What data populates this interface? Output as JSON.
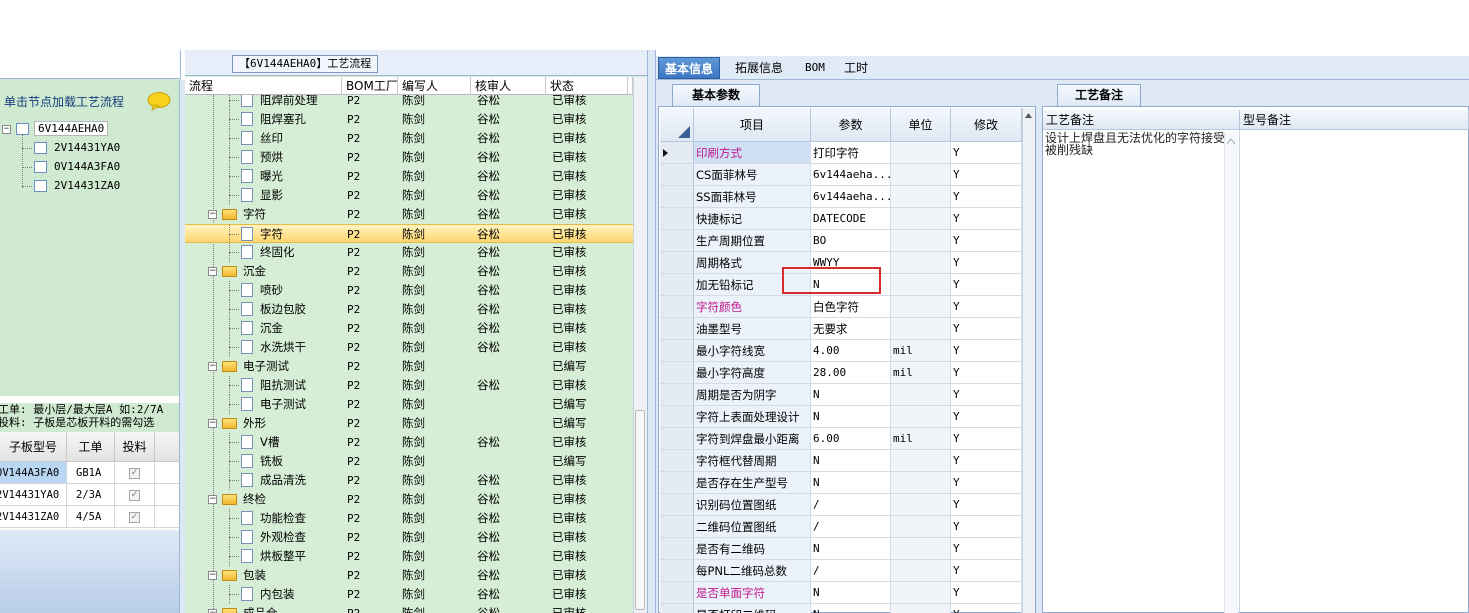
{
  "left": {
    "hint": "单击节点加载工艺流程",
    "tree": {
      "root": "6V144AEHA0",
      "children": [
        "2V14431YA0",
        "0V144A3FA0",
        "2V14431ZA0"
      ]
    },
    "note_line1": "工单: 最小层/最大层A 如:2/7A",
    "note_line2": "投料: 子板是芯板开料的需勾选",
    "sub_grid": {
      "headers": [
        "子板型号",
        "工单",
        "投料"
      ],
      "rows": [
        {
          "model": "0V144A3FA0",
          "order": "GB1A",
          "checked": true
        },
        {
          "model": "2V14431YA0",
          "order": "2/3A",
          "checked": true
        },
        {
          "model": "2V14431ZA0",
          "order": "4/5A",
          "checked": true
        }
      ]
    }
  },
  "middle": {
    "title": "【6V144AEHA0】工艺流程",
    "headers": [
      "流程",
      "BOM工厂",
      "编写人",
      "核审人",
      "状态"
    ],
    "rows": [
      {
        "level": 2,
        "name": "阻焊前处理",
        "factory": "P2",
        "writer": "陈剑",
        "reviewer": "谷松",
        "status": "已审核"
      },
      {
        "level": 2,
        "name": "阻焊塞孔",
        "factory": "P2",
        "writer": "陈剑",
        "reviewer": "谷松",
        "status": "已审核"
      },
      {
        "level": 2,
        "name": "丝印",
        "factory": "P2",
        "writer": "陈剑",
        "reviewer": "谷松",
        "status": "已审核"
      },
      {
        "level": 2,
        "name": "预烘",
        "factory": "P2",
        "writer": "陈剑",
        "reviewer": "谷松",
        "status": "已审核"
      },
      {
        "level": 2,
        "name": "曝光",
        "factory": "P2",
        "writer": "陈剑",
        "reviewer": "谷松",
        "status": "已审核"
      },
      {
        "level": 2,
        "name": "显影",
        "factory": "P2",
        "writer": "陈剑",
        "reviewer": "谷松",
        "status": "已审核"
      },
      {
        "level": 1,
        "name": "字符",
        "factory": "P2",
        "writer": "陈剑",
        "reviewer": "谷松",
        "status": "已审核"
      },
      {
        "level": 2,
        "name": "字符",
        "factory": "P2",
        "writer": "陈剑",
        "reviewer": "谷松",
        "status": "已审核",
        "selected": true
      },
      {
        "level": 2,
        "name": "终固化",
        "factory": "P2",
        "writer": "陈剑",
        "reviewer": "谷松",
        "status": "已审核"
      },
      {
        "level": 1,
        "name": "沉金",
        "factory": "P2",
        "writer": "陈剑",
        "reviewer": "谷松",
        "status": "已审核"
      },
      {
        "level": 2,
        "name": "喷砂",
        "factory": "P2",
        "writer": "陈剑",
        "reviewer": "谷松",
        "status": "已审核"
      },
      {
        "level": 2,
        "name": "板边包胶",
        "factory": "P2",
        "writer": "陈剑",
        "reviewer": "谷松",
        "status": "已审核"
      },
      {
        "level": 2,
        "name": "沉金",
        "factory": "P2",
        "writer": "陈剑",
        "reviewer": "谷松",
        "status": "已审核"
      },
      {
        "level": 2,
        "name": "水洗烘干",
        "factory": "P2",
        "writer": "陈剑",
        "reviewer": "谷松",
        "status": "已审核"
      },
      {
        "level": 1,
        "name": "电子测试",
        "factory": "P2",
        "writer": "陈剑",
        "reviewer": "",
        "status": "已编写"
      },
      {
        "level": 2,
        "name": "阻抗测试",
        "factory": "P2",
        "writer": "陈剑",
        "reviewer": "谷松",
        "status": "已审核"
      },
      {
        "level": 2,
        "name": "电子测试",
        "factory": "P2",
        "writer": "陈剑",
        "reviewer": "",
        "status": "已编写"
      },
      {
        "level": 1,
        "name": "外形",
        "factory": "P2",
        "writer": "陈剑",
        "reviewer": "",
        "status": "已编写"
      },
      {
        "level": 2,
        "name": "V槽",
        "factory": "P2",
        "writer": "陈剑",
        "reviewer": "谷松",
        "status": "已审核"
      },
      {
        "level": 2,
        "name": "铣板",
        "factory": "P2",
        "writer": "陈剑",
        "reviewer": "",
        "status": "已编写"
      },
      {
        "level": 2,
        "name": "成品清洗",
        "factory": "P2",
        "writer": "陈剑",
        "reviewer": "谷松",
        "status": "已审核"
      },
      {
        "level": 1,
        "name": "终检",
        "factory": "P2",
        "writer": "陈剑",
        "reviewer": "谷松",
        "status": "已审核"
      },
      {
        "level": 2,
        "name": "功能检查",
        "factory": "P2",
        "writer": "陈剑",
        "reviewer": "谷松",
        "status": "已审核"
      },
      {
        "level": 2,
        "name": "外观检查",
        "factory": "P2",
        "writer": "陈剑",
        "reviewer": "谷松",
        "status": "已审核"
      },
      {
        "level": 2,
        "name": "烘板整平",
        "factory": "P2",
        "writer": "陈剑",
        "reviewer": "谷松",
        "status": "已审核"
      },
      {
        "level": 1,
        "name": "包装",
        "factory": "P2",
        "writer": "陈剑",
        "reviewer": "谷松",
        "status": "已审核"
      },
      {
        "level": 2,
        "name": "内包装",
        "factory": "P2",
        "writer": "陈剑",
        "reviewer": "谷松",
        "status": "已审核"
      },
      {
        "level": 1,
        "name": "成品仓",
        "factory": "P2",
        "writer": "陈剑",
        "reviewer": "谷松",
        "status": "已审核"
      }
    ]
  },
  "right": {
    "tabs": [
      "基本信息",
      "拓展信息",
      "BOM",
      "工时"
    ],
    "params_tab": "基本参数",
    "params_headers": [
      "项目",
      "参数",
      "单位",
      "修改"
    ],
    "params": [
      {
        "name": "印刷方式",
        "value": "打印字符",
        "unit": "",
        "edit": "Y",
        "pink": true,
        "current": true
      },
      {
        "name": "CS面菲林号",
        "value": "6v144aeha...",
        "unit": "",
        "edit": "Y"
      },
      {
        "name": "SS面菲林号",
        "value": "6v144aeha...",
        "unit": "",
        "edit": "Y"
      },
      {
        "name": "快捷标记",
        "value": "DATECODE",
        "unit": "",
        "edit": "Y"
      },
      {
        "name": "生产周期位置",
        "value": "BO",
        "unit": "",
        "edit": "Y"
      },
      {
        "name": "周期格式",
        "value": "WWYY",
        "unit": "",
        "edit": "Y"
      },
      {
        "name": "加无铅标记",
        "value": "N",
        "unit": "",
        "edit": "Y"
      },
      {
        "name": "字符颜色",
        "value": "白色字符",
        "unit": "",
        "edit": "Y",
        "pink": true
      },
      {
        "name": "油墨型号",
        "value": "无要求",
        "unit": "",
        "edit": "Y"
      },
      {
        "name": "最小字符线宽",
        "value": "4.00",
        "unit": "mil",
        "edit": "Y"
      },
      {
        "name": "最小字符高度",
        "value": "28.00",
        "unit": "mil",
        "edit": "Y"
      },
      {
        "name": "周期是否为阴字",
        "value": "N",
        "unit": "",
        "edit": "Y"
      },
      {
        "name": "字符上表面处理设计",
        "value": "N",
        "unit": "",
        "edit": "Y"
      },
      {
        "name": "字符到焊盘最小距离",
        "value": "6.00",
        "unit": "mil",
        "edit": "Y"
      },
      {
        "name": "字符框代替周期",
        "value": "N",
        "unit": "",
        "edit": "Y"
      },
      {
        "name": "是否存在生产型号",
        "value": "N",
        "unit": "",
        "edit": "Y"
      },
      {
        "name": "识别码位置图纸",
        "value": "/",
        "unit": "",
        "edit": "Y"
      },
      {
        "name": "二维码位置图纸",
        "value": "/",
        "unit": "",
        "edit": "Y"
      },
      {
        "name": "是否有二维码",
        "value": "N",
        "unit": "",
        "edit": "Y"
      },
      {
        "name": "每PNL二维码总数",
        "value": "/",
        "unit": "",
        "edit": "Y"
      },
      {
        "name": "是否单面字符",
        "value": "N",
        "unit": "",
        "edit": "Y",
        "pink": true
      },
      {
        "name": "是否打印二维码",
        "value": "N",
        "unit": "",
        "edit": "Y"
      }
    ],
    "notes_tab": "工艺备注",
    "notes_headers": [
      "工艺备注",
      "型号备注"
    ],
    "note_text": "设计上焊盘且无法优化的字符接受被削残缺"
  },
  "colors": {
    "tree_bg": "#d6eed6",
    "pink_label": "#c0178c",
    "highlight": "#d62b2b",
    "active_tab": "#3b77c4"
  }
}
